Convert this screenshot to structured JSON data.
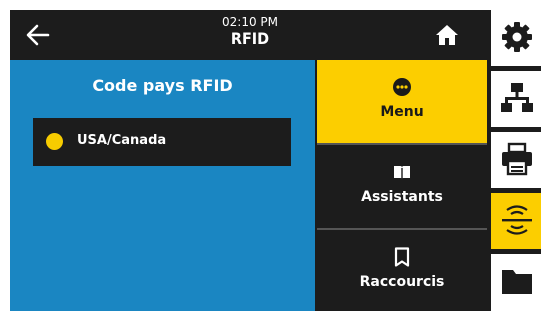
{
  "header": {
    "time": "02:10 PM",
    "title": "RFID"
  },
  "setting": {
    "title": "Code pays RFID",
    "selected_option": "USA/Canada"
  },
  "menu": [
    {
      "label": "Menu",
      "icon": "menu-dots-icon",
      "active": true
    },
    {
      "label": "Assistants",
      "icon": "book-icon",
      "active": false
    },
    {
      "label": "Raccourcis",
      "icon": "bookmark-icon",
      "active": false
    }
  ],
  "sidebar": [
    {
      "icon": "gear-icon",
      "active": false
    },
    {
      "icon": "network-icon",
      "active": false
    },
    {
      "icon": "printer-icon",
      "active": false
    },
    {
      "icon": "rfid-icon",
      "active": true
    },
    {
      "icon": "folder-icon",
      "active": false
    }
  ],
  "colors": {
    "accent": "#fcce00",
    "panel_blue": "#1a86c2",
    "dark": "#1c1c1c"
  }
}
